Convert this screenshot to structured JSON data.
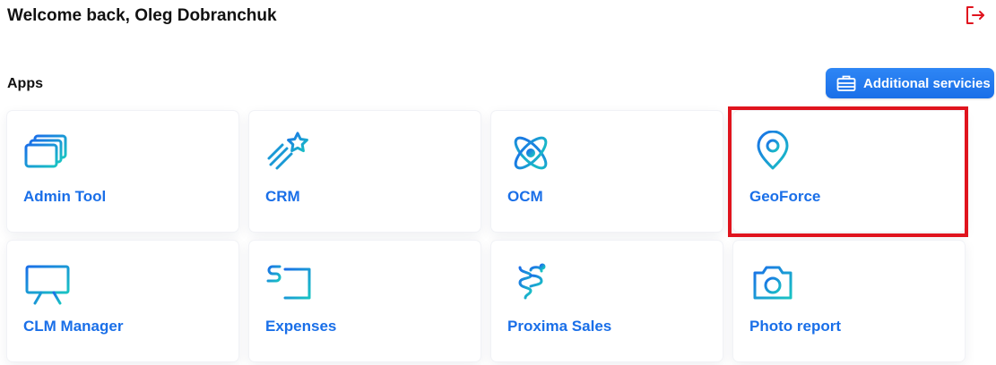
{
  "header": {
    "welcome_text": "Welcome back, Oleg Dobranchuk",
    "logout_icon": "logout-icon",
    "logout_color": "#e0141e"
  },
  "apps_section": {
    "title": "Apps",
    "additional_services_label": "Additional servicies",
    "additional_services_icon": "briefcase-icon",
    "button_color": "#1a6fe8"
  },
  "apps": [
    {
      "label": "Admin Tool",
      "icon": "windows-icon"
    },
    {
      "label": "CRM",
      "icon": "shooting-star-icon"
    },
    {
      "label": "OCM",
      "icon": "atom-icon"
    },
    {
      "label": "GeoForce",
      "icon": "map-pin-icon",
      "highlighted": true
    },
    {
      "label": "CLM Manager",
      "icon": "presentation-chart-icon"
    },
    {
      "label": "Expenses",
      "icon": "dollar-card-icon"
    },
    {
      "label": "Proxima Sales",
      "icon": "caduceus-icon"
    },
    {
      "label": "Photo report",
      "icon": "camera-icon"
    }
  ],
  "colors": {
    "accent_blue": "#1a6fe8",
    "icon_gradient_start": "#1a6fe8",
    "icon_gradient_end": "#19c3c3",
    "highlight_red": "#e0141e"
  }
}
